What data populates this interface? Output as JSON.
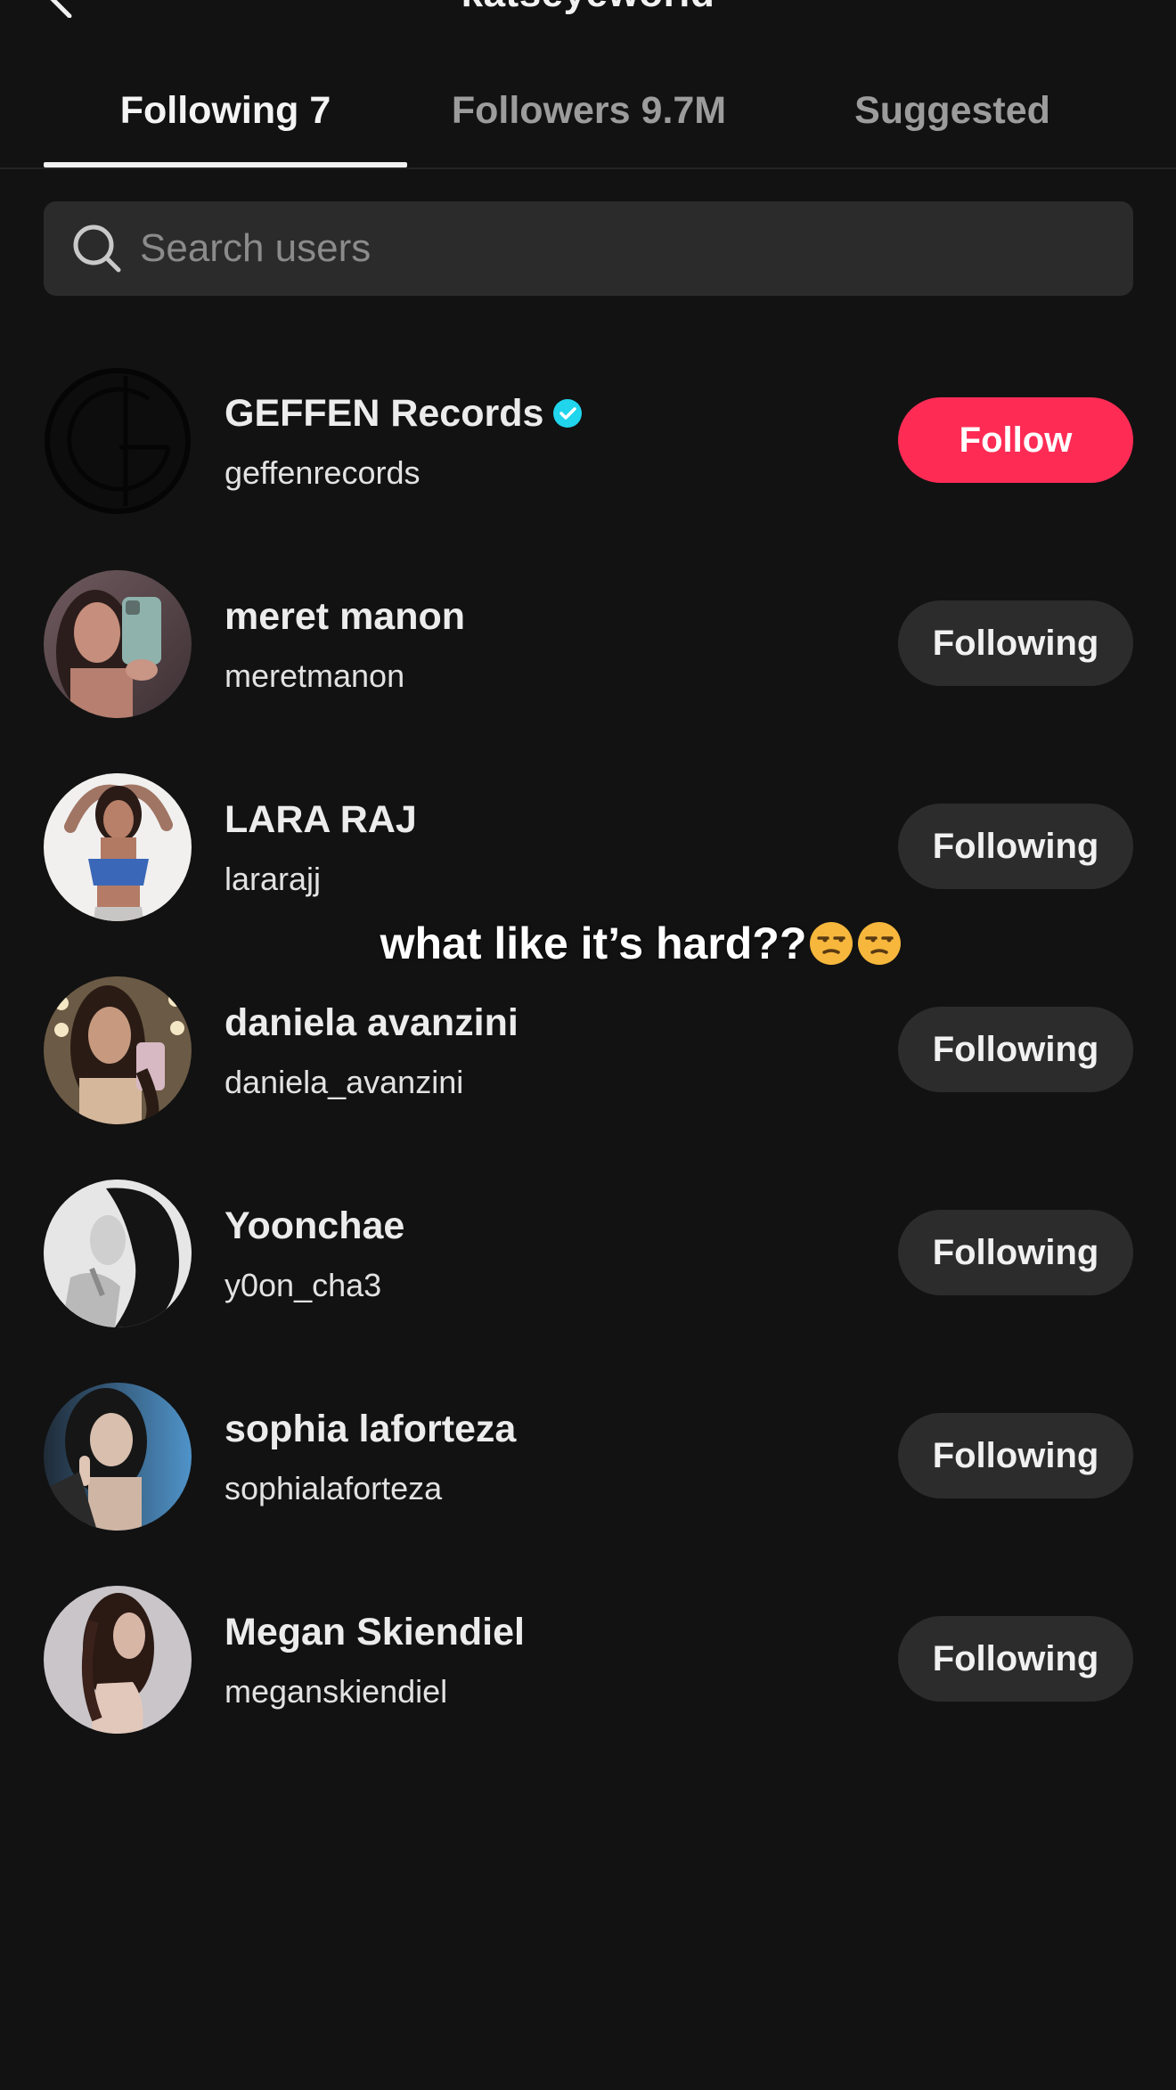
{
  "header": {
    "title": "katseyeworld"
  },
  "tabs": [
    {
      "label": "Following 7",
      "active": true
    },
    {
      "label": "Followers 9.7M",
      "active": false
    },
    {
      "label": "Suggested",
      "active": false
    }
  ],
  "search": {
    "placeholder": "Search users",
    "value": ""
  },
  "users": [
    {
      "name": "GEFFEN Records",
      "handle": "geffenrecords",
      "verified": true,
      "button": "Follow",
      "button_state": "follow"
    },
    {
      "name": "meret manon",
      "handle": "meretmanon",
      "verified": false,
      "button": "Following",
      "button_state": "following"
    },
    {
      "name": "LARA RAJ",
      "handle": "lararajj",
      "verified": false,
      "button": "Following",
      "button_state": "following"
    },
    {
      "name": "daniela avanzini",
      "handle": "daniela_avanzini",
      "verified": false,
      "button": "Following",
      "button_state": "following"
    },
    {
      "name": "Yoonchae",
      "handle": "y0on_cha3",
      "verified": false,
      "button": "Following",
      "button_state": "following"
    },
    {
      "name": "sophia laforteza",
      "handle": "sophialaforteza",
      "verified": false,
      "button": "Following",
      "button_state": "following"
    },
    {
      "name": "Megan Skiendiel",
      "handle": "meganskiendiel",
      "verified": false,
      "button": "Following",
      "button_state": "following"
    }
  ],
  "overlay_caption": {
    "text": "what like it’s hard??",
    "emoji": "unamused-face-emoji x2"
  },
  "colors": {
    "background": "#121212",
    "follow_button": "#fe2c55",
    "following_button": "#2c2c2c",
    "search_bg": "#2b2b2b",
    "verified_badge": "#20d5ec"
  }
}
